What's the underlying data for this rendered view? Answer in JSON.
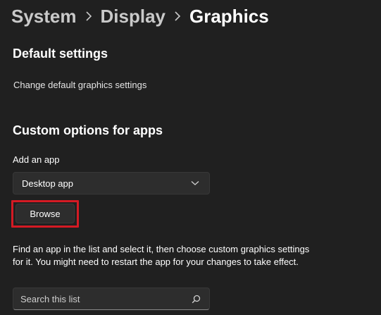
{
  "breadcrumb": {
    "items": [
      "System",
      "Display"
    ],
    "current": "Graphics"
  },
  "default_settings": {
    "title": "Default settings",
    "link": "Change default graphics settings"
  },
  "custom_options": {
    "title": "Custom options for apps",
    "add_app_label": "Add an app",
    "app_type_selected": "Desktop app",
    "browse_label": "Browse",
    "description": "Find an app in the list and select it, then choose custom graphics settings for it. You might need to restart the app for your changes to take effect.",
    "search_placeholder": "Search this list"
  },
  "colors": {
    "background": "#202020",
    "control": "#2d2d2d",
    "highlight": "#d41a24"
  }
}
